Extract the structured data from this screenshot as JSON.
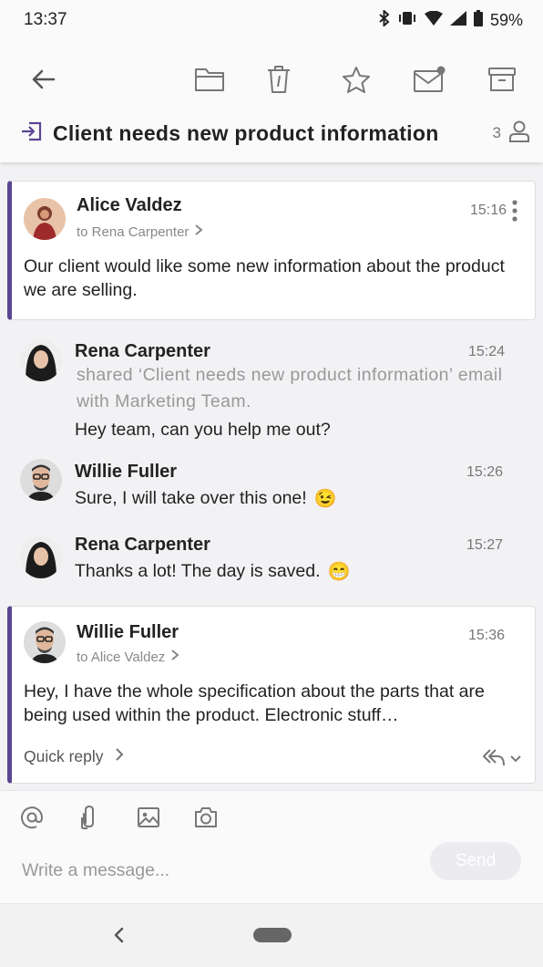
{
  "status_bar": {
    "time": "13:37",
    "battery": "59%"
  },
  "toolbar": {
    "icons": [
      "back-arrow-icon",
      "folder-icon",
      "trash-icon",
      "star-icon",
      "mark-unread-icon",
      "archive-icon"
    ]
  },
  "conversation": {
    "subject": "Client needs new product information",
    "participant_count": "3"
  },
  "messages": [
    {
      "sender": "Alice Valdez",
      "recipient": "to Rena Carpenter",
      "time": "15:16",
      "body": "Our client would like some new information about the product we are selling."
    },
    {
      "sender": "Rena Carpenter",
      "time": "15:24",
      "shared": "shared ‘Client needs new product information’ email with Marketing Team.",
      "text": "Hey team, can you help me out?"
    },
    {
      "sender": "Willie Fuller",
      "time": "15:26",
      "text": "Sure, I will take over this one!",
      "emoji": "😉"
    },
    {
      "sender": "Rena Carpenter",
      "time": "15:27",
      "text": "Thanks a lot! The day is saved.",
      "emoji": "😁"
    },
    {
      "sender": "Willie Fuller",
      "recipient": "to Alice Valdez",
      "time": "15:36",
      "body": "Hey, I have the whole specification about the parts that are being used within the product. Electronic stuff…",
      "quick_reply": "Quick reply"
    }
  ],
  "composer": {
    "placeholder": "Write a message...",
    "send_label": "Send"
  },
  "colors": {
    "accent": "#5b4592",
    "text": "#222222",
    "muted": "#888888"
  }
}
